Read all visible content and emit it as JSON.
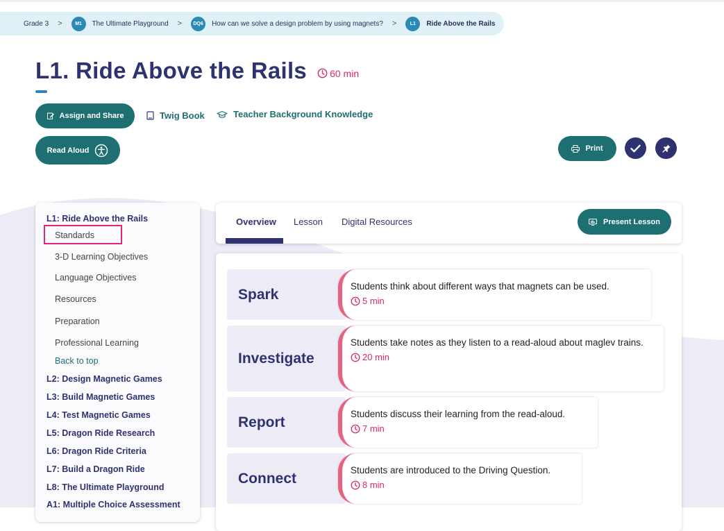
{
  "breadcrumb": {
    "grade": "Grade 3",
    "separator": ">",
    "module": {
      "badge": "M1",
      "label": "The Ultimate Playground"
    },
    "question": {
      "badge": "DQ6",
      "label": "How can we solve a design problem by using magnets?"
    },
    "lesson": {
      "badge": "L1",
      "label": "Ride Above the Rails"
    }
  },
  "header": {
    "title": "L1. Ride Above the Rails",
    "duration": "60 min"
  },
  "actions": {
    "assign_share": "Assign and Share",
    "twig_book": "Twig Book",
    "teacher_background": "Teacher Background Knowledge",
    "read_aloud": "Read Aloud",
    "print": "Print"
  },
  "sidebar": {
    "current_lesson": "L1: Ride Above the Rails",
    "sections": [
      "Standards",
      "3-D Learning Objectives",
      "Language Objectives",
      "Resources",
      "Preparation",
      "Professional Learning"
    ],
    "back_to_top": "Back to top",
    "lessons": [
      "L2: Design Magnetic Games",
      "L3: Build Magnetic Games",
      "L4: Test Magnetic Games",
      "L5: Dragon Ride Research",
      "L6: Dragon Ride Criteria",
      "L7: Build a Dragon Ride",
      "L8: The Ultimate Playground",
      "A1: Multiple Choice Assessment"
    ]
  },
  "tabs": {
    "items": [
      "Overview",
      "Lesson",
      "Digital Resources"
    ],
    "active": "Overview",
    "present_lesson": "Present Lesson"
  },
  "phases": [
    {
      "name": "Spark",
      "description": "Students think about different ways that magnets can be used.",
      "duration": "5 min"
    },
    {
      "name": "Investigate",
      "description": "Students take notes as they listen to a read-aloud about maglev trains.",
      "duration": "20 min"
    },
    {
      "name": "Report",
      "description": "Students discuss their learning from the read-aloud.",
      "duration": "7 min"
    },
    {
      "name": "Connect",
      "description": "Students are introduced to the Driving Question.",
      "duration": "8 min"
    }
  ],
  "colors": {
    "navy": "#2f3270",
    "teal": "#1e6f72",
    "magenta": "#d6286c",
    "phase_accent": "#e6637f",
    "highlight_box": "#e5237d",
    "breadcrumb_bg": "#dff1f7"
  }
}
